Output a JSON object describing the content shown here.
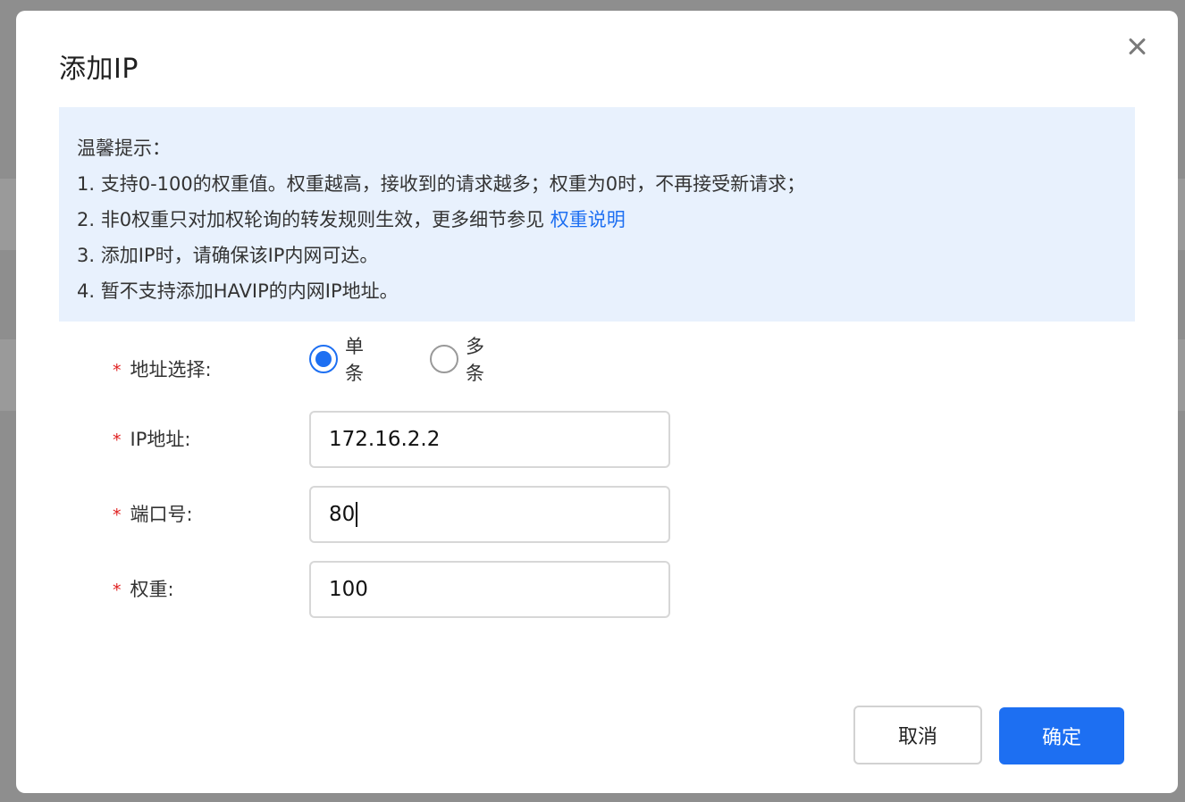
{
  "dialog": {
    "title": "添加IP"
  },
  "tips": {
    "heading": "温馨提示：",
    "line1": "1. 支持0-100的权重值。权重越高，接收到的请求越多；权重为0时，不再接受新请求；",
    "line2_text": "2. 非0权重只对加权轮询的转发规则生效，更多细节参见 ",
    "line2_link": "权重说明",
    "line3": "3. 添加IP时，请确保该IP内网可达。",
    "line4": "4. 暂不支持添加HAVIP的内网IP地址。"
  },
  "form": {
    "required_mark": "*",
    "address_mode": {
      "label": "地址选择:",
      "options": [
        "单条",
        "多条"
      ],
      "selected": "单条"
    },
    "ip": {
      "label": "IP地址:",
      "value": "172.16.2.2"
    },
    "port": {
      "label": "端口号:",
      "value": "80"
    },
    "weight": {
      "label": "权重:",
      "value": "100"
    }
  },
  "footer": {
    "cancel_label": "取消",
    "ok_label": "确定"
  },
  "colors": {
    "primary": "#1d6ff2",
    "required": "#e02020",
    "tip_background": "#e8f1fd"
  }
}
